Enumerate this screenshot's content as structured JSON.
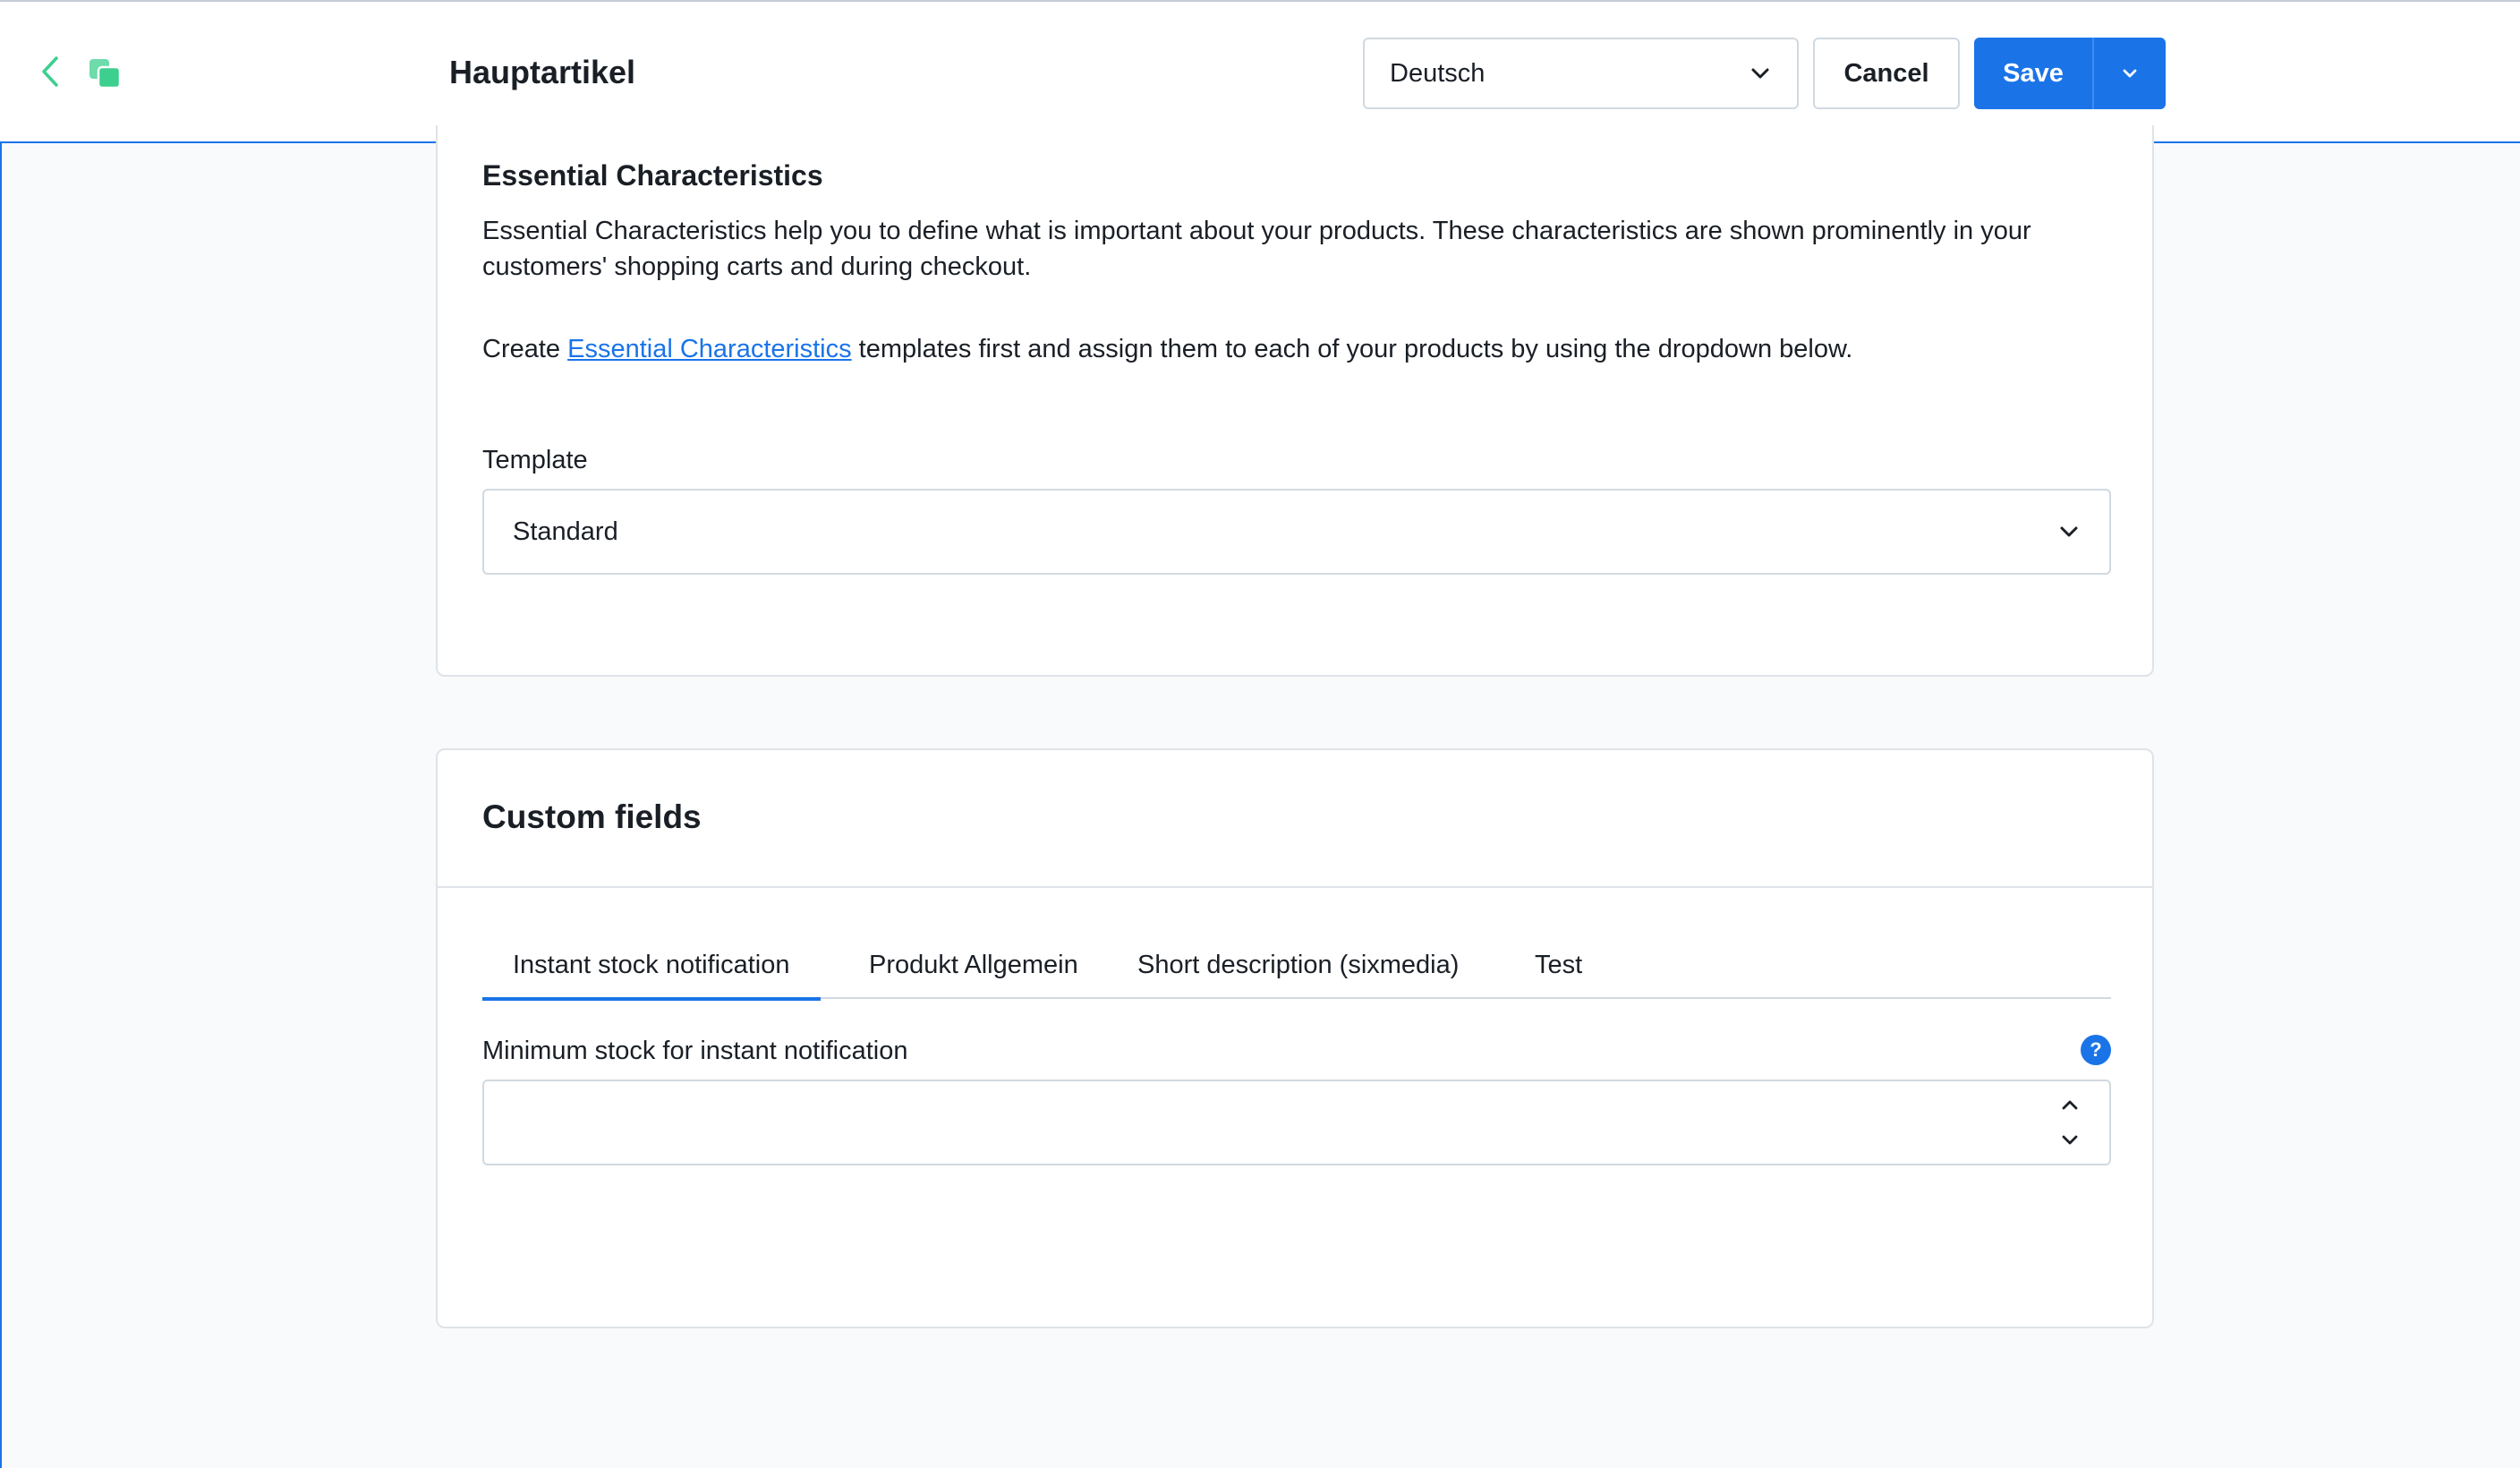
{
  "header": {
    "title": "Hauptartikel",
    "language": "Deutsch",
    "cancel_label": "Cancel",
    "save_label": "Save",
    "icons": [
      "chevron-left-icon",
      "copy-icon",
      "chevron-down-icon"
    ],
    "accent_color": "#1a74e8",
    "icon_color": "#3ccf8e"
  },
  "essential_characteristics": {
    "title": "Essential Characteristics",
    "description": "Essential Characteristics help you to define what is important about your products. These characteristics are shown prominently in your customers' shopping carts and during checkout.",
    "create_prefix": "Create ",
    "create_link": "Essential Characteristics",
    "create_suffix": " templates first and assign them to each of your products by using the dropdown below.",
    "template_label": "Template",
    "template_value": "Standard"
  },
  "custom_fields": {
    "title": "Custom fields",
    "tabs": [
      {
        "label": "Instant stock notification",
        "active": true
      },
      {
        "label": "Produkt Allgemein",
        "active": false
      },
      {
        "label": "Short description (sixmedia)",
        "active": false
      },
      {
        "label": "Test",
        "active": false
      }
    ],
    "field_label": "Minimum stock for instant notification",
    "field_value": "",
    "help_glyph": "?"
  }
}
